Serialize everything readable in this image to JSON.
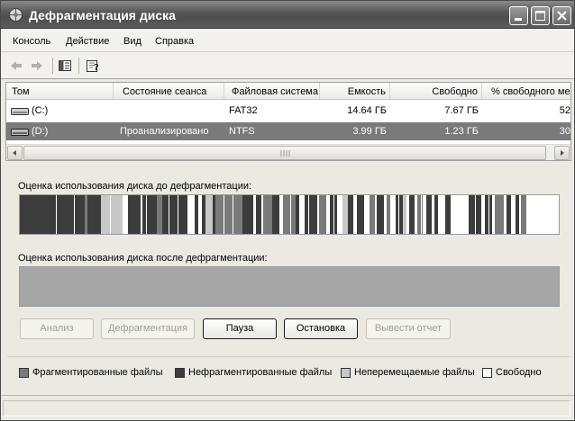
{
  "window": {
    "title": "Дефрагментация диска"
  },
  "menu": {
    "items": [
      "Консоль",
      "Действие",
      "Вид",
      "Справка"
    ]
  },
  "toolbar": {
    "icons": [
      "back-arrow-icon",
      "forward-arrow-icon",
      "show-hide-tree-icon",
      "help-icon"
    ]
  },
  "volumes": {
    "columns": [
      "Том",
      "Состояние сеанса",
      "Файловая система",
      "Емкость",
      "Свободно",
      "% свободного места"
    ],
    "rows": [
      {
        "volume": "(C:)",
        "status": "",
        "fs": "FAT32",
        "capacity": "14.64 ГБ",
        "free": "7.67 ГБ",
        "percent": "52",
        "selected": false
      },
      {
        "volume": "(D:)",
        "status": "Проанализировано",
        "fs": "NTFS",
        "capacity": "3.99 ГБ",
        "free": "1.23 ГБ",
        "percent": "30",
        "selected": true
      }
    ]
  },
  "analysis": {
    "before_label": "Оценка использования диска до дефрагментации:",
    "after_label": "Оценка использования диска после дефрагментации:"
  },
  "buttons": {
    "analyze": "Анализ",
    "defragment": "Дефрагментация",
    "pause": "Пауза",
    "stop": "Остановка",
    "report": "Вывести отчет"
  },
  "legend": {
    "fragmented": "Фрагментированные файлы",
    "contiguous": "Нефрагментированные файлы",
    "unmovable": "Неперемещаемые файлы",
    "free": "Свободно"
  },
  "colors": {
    "fragmented": "#7a7a7a",
    "contiguous": "#3c3c3c",
    "unmovable": "#c8c8c8",
    "free": "#ffffff",
    "selected_row": "#7a7a7a"
  }
}
